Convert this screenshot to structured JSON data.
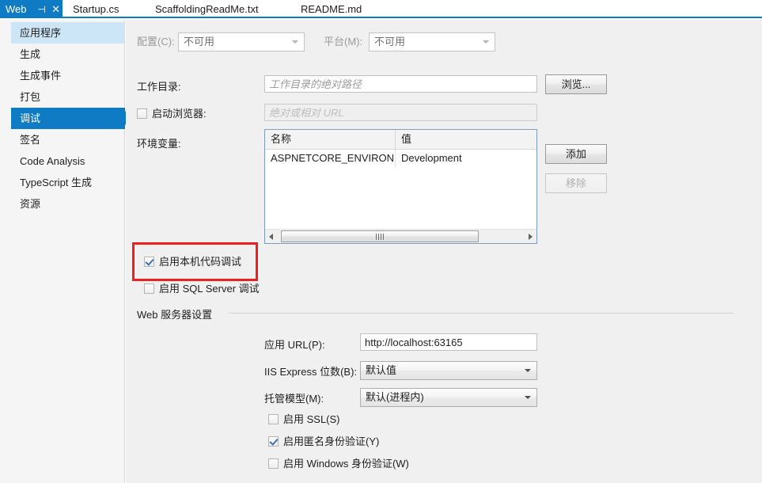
{
  "tabs": [
    {
      "label": "Web",
      "active": true,
      "pin_icon": "pin-icon",
      "close_icon": "close-icon"
    },
    {
      "label": "Startup.cs",
      "active": false
    },
    {
      "label": "ScaffoldingReadMe.txt",
      "active": false
    },
    {
      "label": "README.md",
      "active": false
    }
  ],
  "sidebar": {
    "items": [
      {
        "label": "应用程序",
        "state": "hover"
      },
      {
        "label": "生成",
        "state": "normal"
      },
      {
        "label": "生成事件",
        "state": "normal"
      },
      {
        "label": "打包",
        "state": "normal"
      },
      {
        "label": "调试",
        "state": "selected"
      },
      {
        "label": "签名",
        "state": "normal"
      },
      {
        "label": "Code Analysis",
        "state": "normal"
      },
      {
        "label": "TypeScript 生成",
        "state": "normal"
      },
      {
        "label": "资源",
        "state": "normal"
      }
    ]
  },
  "config_row": {
    "configuration_label": "配置(C):",
    "configuration_value": "不可用",
    "platform_label": "平台(M):",
    "platform_value": "不可用"
  },
  "debug": {
    "working_dir_label": "工作目录:",
    "working_dir_value": "",
    "working_dir_placeholder": "工作目录的绝对路径",
    "browse_button": "浏览...",
    "launch_browser_label": "启动浏览器:",
    "launch_browser_checked": false,
    "launch_url_value": "",
    "launch_url_placeholder": "绝对或相对 URL",
    "env_label": "环境变量:",
    "env_columns": [
      "名称",
      "值"
    ],
    "env_rows": [
      {
        "name": "ASPNETCORE_ENVIRONMENT",
        "value": "Development"
      }
    ],
    "add_button": "添加",
    "remove_button": "移除",
    "native_debug_label": "启用本机代码调试",
    "native_debug_checked": true,
    "sql_debug_label": "启用 SQL Server 调试",
    "sql_debug_checked": false
  },
  "web_server": {
    "section_title": "Web 服务器设置",
    "app_url_label": "应用 URL(P):",
    "app_url_value": "http://localhost:63165",
    "iis_bitness_label": "IIS Express 位数(B):",
    "iis_bitness_value": "默认值",
    "hosting_model_label": "托管模型(M):",
    "hosting_model_value": "默认(进程内)",
    "ssl_label": "启用 SSL(S)",
    "ssl_checked": false,
    "anonymous_label": "启用匿名身份验证(Y)",
    "anonymous_checked": true,
    "windows_auth_label": "启用 Windows 身份验证(W)",
    "windows_auth_checked": false
  },
  "colors": {
    "accent": "#0f7bc4",
    "highlight": "#ef1f1f",
    "panel_bg": "#f0f0f0",
    "sidebar_bg": "#f5f5f5"
  }
}
